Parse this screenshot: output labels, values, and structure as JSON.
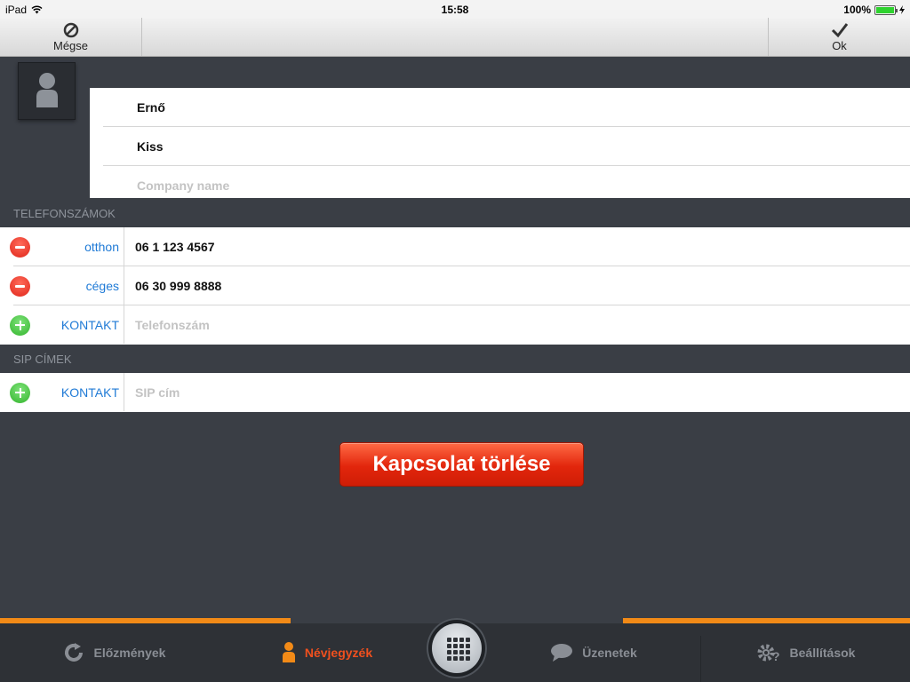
{
  "status_bar": {
    "device": "iPad",
    "time": "15:58",
    "battery": "100%"
  },
  "toolbar": {
    "cancel_label": "Mégse",
    "ok_label": "Ok"
  },
  "contact": {
    "first_name": "Ernő",
    "last_name": "Kiss",
    "company_placeholder": "Company name"
  },
  "phones": {
    "header": "TELEFONSZÁMOK",
    "items": [
      {
        "label": "otthon",
        "value": "06 1 123 4567"
      },
      {
        "label": "céges",
        "value": "06 30 999 8888"
      }
    ],
    "add": {
      "label": "KONTAKT",
      "placeholder": "Telefonszám"
    }
  },
  "sip": {
    "header": "SIP CÍMEK",
    "add": {
      "label": "KONTAKT",
      "placeholder": "SIP cím"
    }
  },
  "delete_button": "Kapcsolat törlése",
  "tabs": [
    {
      "label": "Előzmények",
      "icon": "refresh-icon"
    },
    {
      "label": "Névjegyzék",
      "icon": "person-icon"
    },
    {
      "label": "Üzenetek",
      "icon": "chat-bubble-icon"
    },
    {
      "label": "Beállítások",
      "icon": "gear-icon"
    }
  ],
  "colors": {
    "accent_orange": "#f28a17",
    "delete_red": "#e2260c",
    "link_blue": "#1f7ad6",
    "active_tab": "#f0501e"
  }
}
